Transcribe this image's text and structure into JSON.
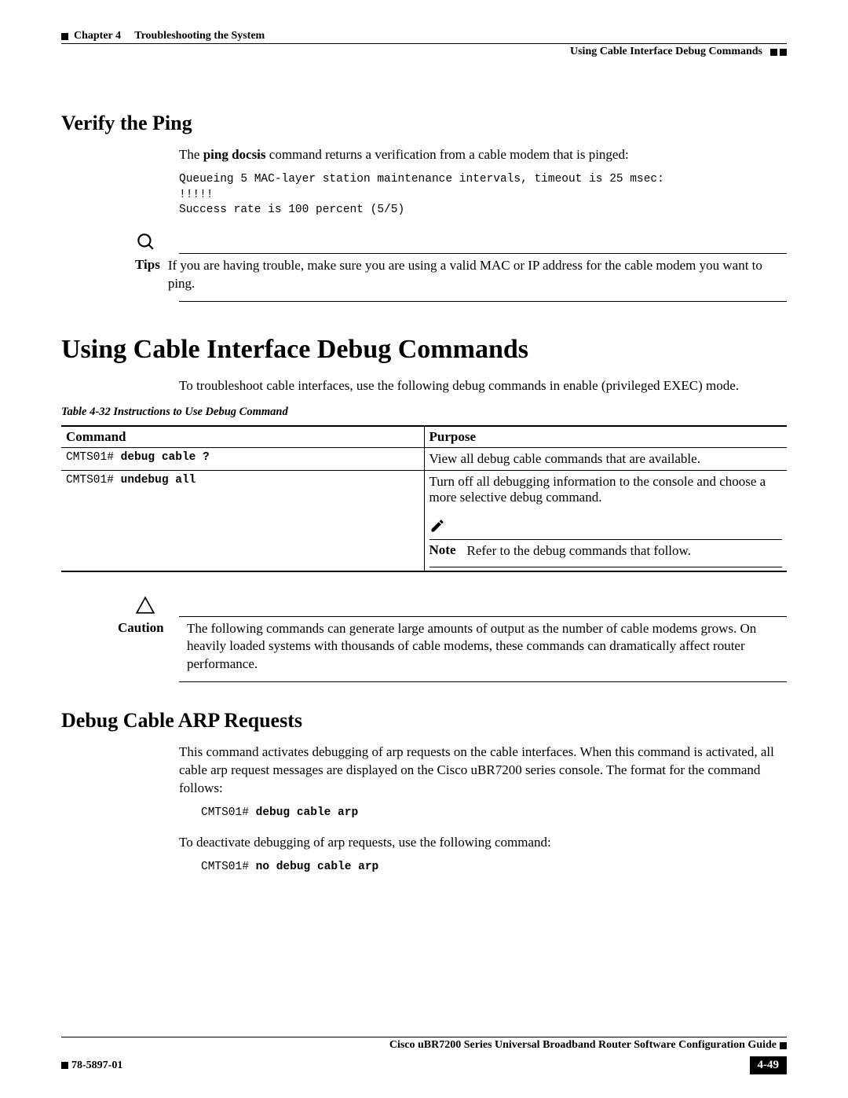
{
  "header": {
    "chapter_prefix": "Chapter 4",
    "chapter_title": "Troubleshooting the System",
    "section": "Using Cable Interface Debug Commands"
  },
  "section1": {
    "title": "Verify the Ping",
    "intro_pre": "The ",
    "intro_cmd": "ping docsis",
    "intro_post": " command returns a verification from a cable modem that is pinged:",
    "code": "Queueing 5 MAC-layer station maintenance intervals, timeout is 25 msec:\n!!!!!\nSuccess rate is 100 percent (5/5)",
    "tip_label": "Tips",
    "tip_text": "If you are having trouble, make sure you are using a valid MAC or IP address for the cable modem you want to ping."
  },
  "section2": {
    "title": "Using Cable Interface Debug Commands",
    "intro": "To troubleshoot cable interfaces, use the following debug commands in enable (privileged EXEC) mode.",
    "table_caption": "Table 4-32    Instructions to Use Debug Command",
    "table": {
      "headers": {
        "command": "Command",
        "purpose": "Purpose"
      },
      "rows": [
        {
          "prompt": "CMTS01# ",
          "cmd": "debug cable ?",
          "purpose": "View all debug cable commands that are available."
        },
        {
          "prompt": "CMTS01# ",
          "cmd": "undebug all",
          "purpose": "Turn off all debugging information to the console and choose a more selective debug command.",
          "note_label": "Note",
          "note_text": "Refer to the debug commands that follow."
        }
      ]
    },
    "caution_label": "Caution",
    "caution_text": "The following commands can generate large amounts of output as the number of cable modems grows. On heavily loaded systems with thousands of cable modems, these commands can dramatically affect router performance."
  },
  "section3": {
    "title": "Debug Cable ARP Requests",
    "p1": "This command activates debugging of arp requests on the cable interfaces. When this command is activated, all cable arp request messages are displayed on the Cisco uBR7200 series console. The format for the command follows:",
    "code1_prompt": "CMTS01# ",
    "code1_cmd": "debug cable arp",
    "p2": "To deactivate debugging of arp requests, use the following command:",
    "code2_prompt": "CMTS01# ",
    "code2_cmd": "no debug cable arp"
  },
  "footer": {
    "guide_title": "Cisco uBR7200 Series Universal Broadband Router Software Configuration Guide",
    "doc_number": "78-5897-01",
    "page_number": "4-49"
  }
}
